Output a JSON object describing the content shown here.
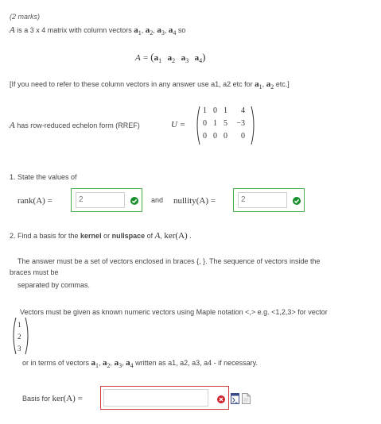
{
  "header": {
    "marks": "(2 marks)",
    "intro_mid": " is a 3 x 4  matrix with column vectors ",
    "intro_so": " so",
    "matrix_var": "A"
  },
  "vectors": {
    "a1": "a",
    "a2": "a",
    "a3": "a",
    "a4": "a",
    "s1": "1",
    "s2": "2",
    "s3": "3",
    "s4": "4"
  },
  "definition": {
    "lhs": "A ="
  },
  "note": {
    "text": "[If you need to refer to these column vectors in any answer use a1, a2 etc for ",
    "end": " etc.]"
  },
  "rref": {
    "label": " has row-reduced echelon form (RREF)",
    "lhs": "U =",
    "rows": [
      [
        "1",
        "0",
        "1",
        "4"
      ],
      [
        "0",
        "1",
        "5",
        "−3"
      ],
      [
        "0",
        "0",
        "0",
        "0"
      ]
    ]
  },
  "q1": {
    "text": "1. State the values of",
    "rank_label": "rank(A) =",
    "rank_value": "2",
    "and": "and",
    "nullity_label": "nullity(A) =",
    "nullity_value": "2"
  },
  "q2": {
    "text_pre": "2. Find a basis for the ",
    "kernel": "kernel",
    "or": " or ",
    "nullspace": "nullspace",
    "of": " of ",
    "A": "A",
    "comma": ", ",
    "ker": "ker(A)",
    "dot": " ."
  },
  "instructions": {
    "line1": "The answer must be a set of vectors enclosed in braces {, }. The sequence of vectors inside the",
    "line2": "braces must be",
    "line3": "separated by commas.",
    "line4": "Vectors must be given as known numeric vectors using Maple notation <,>    e.g.   <1,2,3> for vector",
    "example": [
      "1",
      "2",
      "3"
    ],
    "line5_pre": "or in terms of vectors ",
    "line5_post": " written as a1, a2, a3, a4 - if necessary."
  },
  "answer": {
    "label": "Basis for ",
    "ker": "ker(A) =",
    "value": ""
  },
  "colors": {
    "correct": "#1a8f2e",
    "correct_border": "#4cae4c",
    "error": "#d0212b",
    "error_border": "#d13a3a"
  },
  "icons": [
    "check-icon",
    "check-icon",
    "error-icon",
    "equation-editor-icon",
    "preview-icon"
  ]
}
